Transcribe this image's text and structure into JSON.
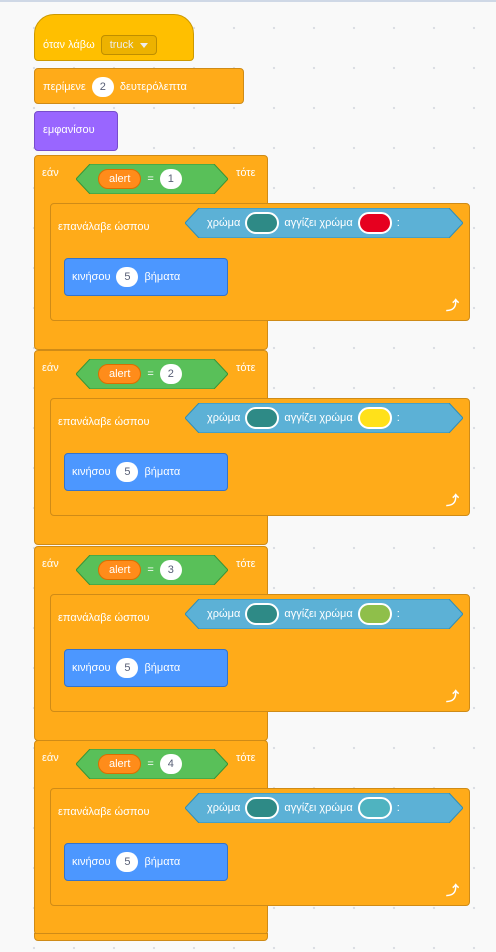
{
  "hat": {
    "label": "όταν λάβω",
    "message": "truck"
  },
  "wait": {
    "label": "περίμενε",
    "value": "2",
    "unit": "δευτερόλεπτα"
  },
  "show": {
    "label": "εμφανίσου"
  },
  "if_blocks": [
    {
      "if_label": "εάν",
      "variable": "alert",
      "op": "=",
      "value": "1",
      "then_label": "τότε",
      "repeat_label": "επανάλαβε ώσπου",
      "color_label": "χρώμα",
      "touch_label": "αγγίζει χρώμα",
      "colon": ":",
      "color1": "#2e8a86",
      "color2": "#e6001f",
      "move_label": "κινήσου",
      "move_value": "5",
      "move_unit": "βήματα"
    },
    {
      "if_label": "εάν",
      "variable": "alert",
      "op": "=",
      "value": "2",
      "then_label": "τότε",
      "repeat_label": "επανάλαβε ώσπου",
      "color_label": "χρώμα",
      "touch_label": "αγγίζει χρώμα",
      "colon": ":",
      "color1": "#2e8a86",
      "color2": "#ffe11a",
      "move_label": "κινήσου",
      "move_value": "5",
      "move_unit": "βήματα"
    },
    {
      "if_label": "εάν",
      "variable": "alert",
      "op": "=",
      "value": "3",
      "then_label": "τότε",
      "repeat_label": "επανάλαβε ώσπου",
      "color_label": "χρώμα",
      "touch_label": "αγγίζει χρώμα",
      "colon": ":",
      "color1": "#2e8a86",
      "color2": "#8fbf4a",
      "move_label": "κινήσου",
      "move_value": "5",
      "move_unit": "βήματα"
    },
    {
      "if_label": "εάν",
      "variable": "alert",
      "op": "=",
      "value": "4",
      "then_label": "τότε",
      "repeat_label": "επανάλαβε ώσπου",
      "color_label": "χρώμα",
      "touch_label": "αγγίζει χρώμα",
      "colon": ":",
      "color1": "#2e8a86",
      "color2": "#4fb3c0",
      "move_label": "κινήσου",
      "move_value": "5",
      "move_unit": "βήματα"
    }
  ],
  "icons": {
    "repeat_end": "loop-arrow-icon",
    "dropdown": "chevron-down-icon"
  }
}
